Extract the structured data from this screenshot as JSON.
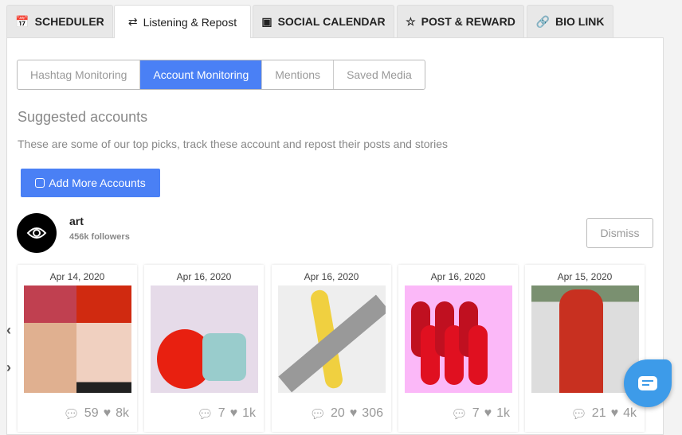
{
  "tabs": [
    {
      "label": "SCHEDULER",
      "icon": "calendar-check-icon"
    },
    {
      "label": "Listening & Repost",
      "icon": "repost-icon"
    },
    {
      "label": "SOCIAL CALENDAR",
      "icon": "calendar-icon"
    },
    {
      "label": "POST & REWARD",
      "icon": "star-icon"
    },
    {
      "label": "BIO LINK",
      "icon": "link-icon"
    }
  ],
  "subtabs": [
    "Hashtag Monitoring",
    "Account Monitoring",
    "Mentions",
    "Saved Media"
  ],
  "section": {
    "title": "Suggested accounts",
    "description": "These are some of our top picks, track these account and repost their posts and stories",
    "add_button": "Add More Accounts"
  },
  "account": {
    "name": "art",
    "followers": "456k followers",
    "dismiss": "Dismiss"
  },
  "posts": [
    {
      "date": "Apr 14, 2020",
      "comments": "59",
      "likes": "8k"
    },
    {
      "date": "Apr 16, 2020",
      "comments": "7",
      "likes": "1k"
    },
    {
      "date": "Apr 16, 2020",
      "comments": "20",
      "likes": "306"
    },
    {
      "date": "Apr 16, 2020",
      "comments": "7",
      "likes": "1k"
    },
    {
      "date": "Apr 15, 2020",
      "comments": "21",
      "likes": "4k"
    }
  ],
  "colors": {
    "accent": "#4a80f5",
    "chat": "#3d9be9"
  }
}
